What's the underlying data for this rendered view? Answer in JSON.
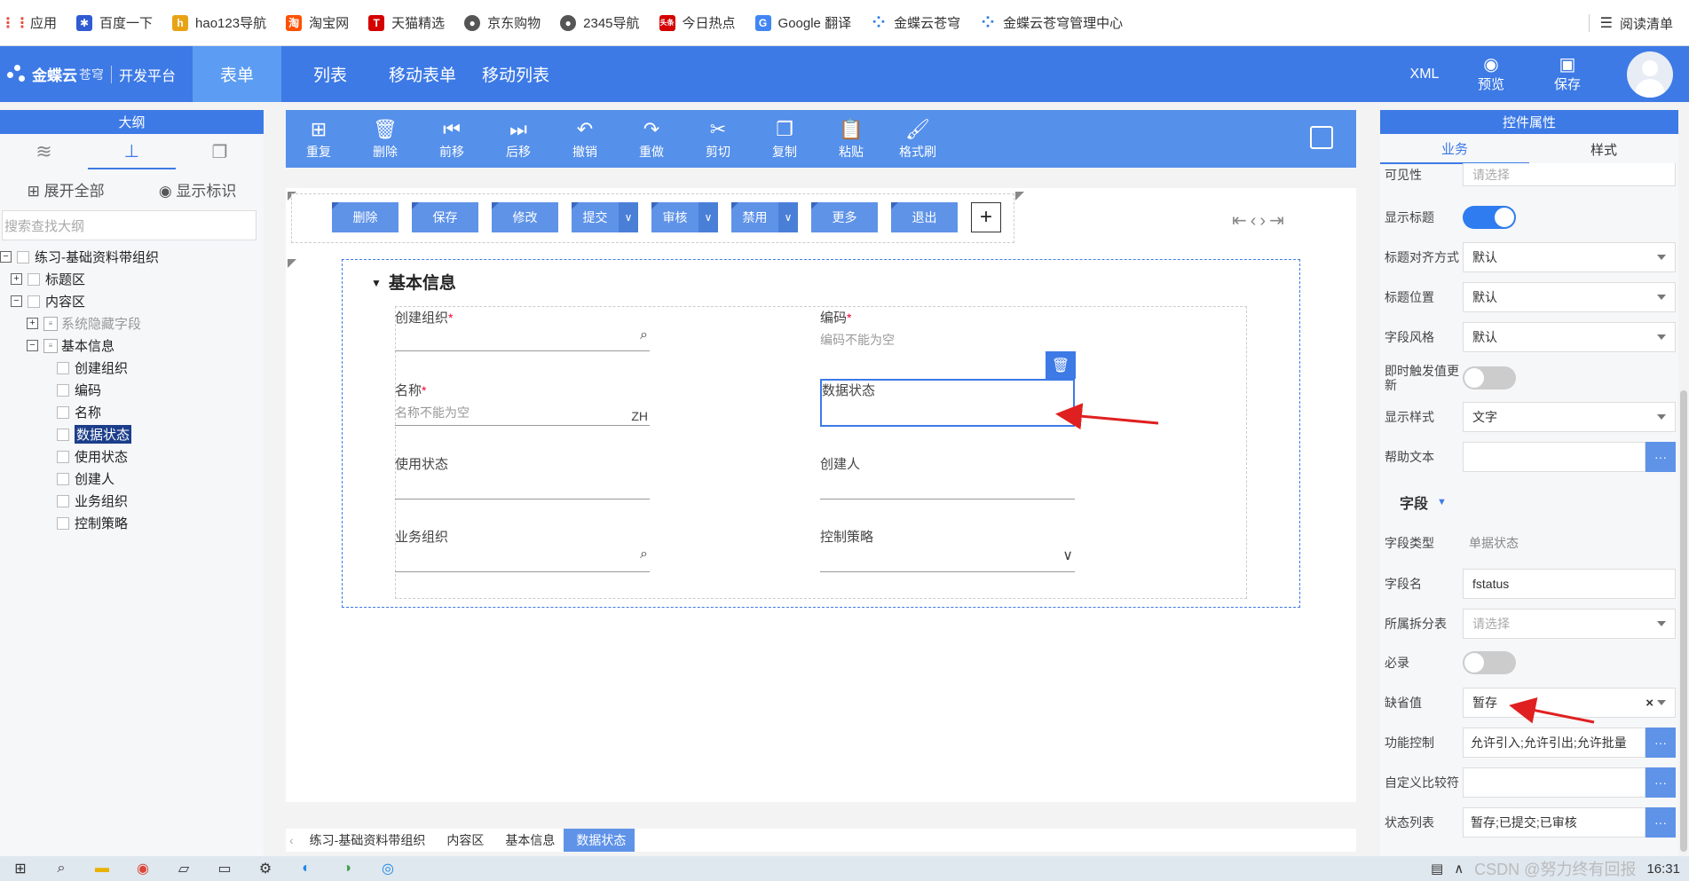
{
  "bookmarks": [
    {
      "label": "应用",
      "icon": "apps-grid-icon",
      "color": "#e74c3c"
    },
    {
      "label": "百度一下",
      "icon": "baidu-paw-icon",
      "color": "#2f5bd3"
    },
    {
      "label": "hao123导航",
      "icon": "hao123-icon",
      "color": "#e8a315"
    },
    {
      "label": "淘宝网",
      "icon": "taobao-icon",
      "color": "#ff5000"
    },
    {
      "label": "天猫精选",
      "icon": "tmall-icon",
      "color": "#d40000"
    },
    {
      "label": "京东购物",
      "icon": "globe-icon",
      "color": "#555555"
    },
    {
      "label": "2345导航",
      "icon": "globe-icon",
      "color": "#555555"
    },
    {
      "label": "今日热点",
      "icon": "news-icon",
      "color": "#d40000"
    },
    {
      "label": "Google 翻译",
      "icon": "google-translate-icon",
      "color": "#4285f4"
    },
    {
      "label": "金蝶云苍穹",
      "icon": "kingdee-icon",
      "color": "#2a7fe0"
    },
    {
      "label": "金蝶云苍穹管理中心",
      "icon": "kingdee-icon",
      "color": "#2a7fe0"
    }
  ],
  "reading_list": "阅读清单",
  "header": {
    "brand": "金蝶云",
    "brand_sub": "苍穹",
    "platform": "开发平台",
    "tabs": [
      "表单",
      "列表",
      "移动表单",
      "移动列表"
    ],
    "xml": "XML",
    "preview": "预览",
    "save": "保存"
  },
  "outline": {
    "title": "大纲",
    "expand_all": "展开全部",
    "show_id": "显示标识",
    "search_placeholder": "搜索查找大纲",
    "tree": {
      "root": "练习-基础资料带组织",
      "title_area": "标题区",
      "content_area": "内容区",
      "hidden_fields": "系统隐藏字段",
      "basic_info": "基本信息",
      "fields": [
        "创建组织",
        "编码",
        "名称",
        "数据状态",
        "使用状态",
        "创建人",
        "业务组织",
        "控制策略"
      ]
    }
  },
  "toolbar": [
    "重复",
    "删除",
    "前移",
    "后移",
    "撤销",
    "重做",
    "剪切",
    "复制",
    "粘贴",
    "格式刷"
  ],
  "action_bar": {
    "delete": "删除",
    "save": "保存",
    "modify": "修改",
    "submit": "提交",
    "audit": "审核",
    "disable": "禁用",
    "more": "更多",
    "exit": "退出"
  },
  "form": {
    "section": "基本信息",
    "create_org": "创建组织",
    "code": "编码",
    "code_ph": "编码不能为空",
    "name": "名称",
    "name_ph": "名称不能为空",
    "name_lang": "ZH",
    "data_status": "数据状态",
    "use_status": "使用状态",
    "creator": "创建人",
    "biz_org": "业务组织",
    "ctrl_strategy": "控制策略"
  },
  "breadcrumb": [
    "练习-基础资料带组织",
    "内容区",
    "基本信息",
    "数据状态"
  ],
  "props": {
    "title": "控件属性",
    "tab_biz": "业务",
    "tab_style": "样式",
    "visible": "可见性",
    "visible_ph": "请选择",
    "show_title": "显示标题",
    "title_align": "标题对齐方式",
    "title_align_val": "默认",
    "title_pos": "标题位置",
    "title_pos_val": "默认",
    "field_style": "字段风格",
    "field_style_val": "默认",
    "instant_update": "即时触发值更新",
    "display_style": "显示样式",
    "display_style_val": "文字",
    "help_text": "帮助文本",
    "field_section": "字段",
    "field_type": "字段类型",
    "field_type_val": "单据状态",
    "field_name": "字段名",
    "field_name_val": "fstatus",
    "split_table": "所属拆分表",
    "split_table_ph": "请选择",
    "required": "必录",
    "default_val": "缺省值",
    "default_val_val": "暂存",
    "func_ctrl": "功能控制",
    "func_ctrl_val": "允许引入;允许引出;允许批量",
    "custom_cmp": "自定义比较符",
    "status_list": "状态列表",
    "status_list_val": "暂存;已提交;已审核",
    "more_btn": "···",
    "clear_x": "×"
  },
  "toggles": {
    "show_title": true,
    "instant_update": false,
    "required": false
  },
  "taskbar": {
    "watermark": "CSDN @努力终有回报",
    "time": "16:31"
  }
}
